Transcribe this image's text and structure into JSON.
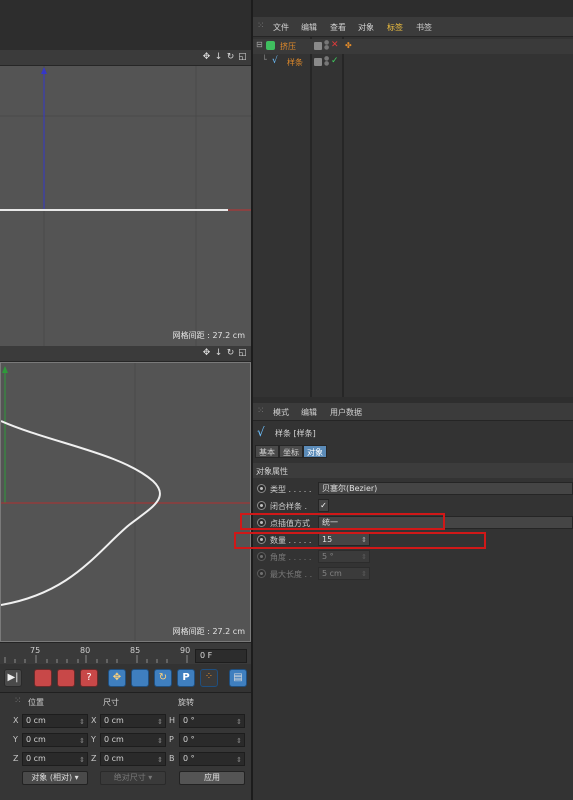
{
  "viewport_top": {
    "grid_spacing": "网格间距 : 27.2 cm"
  },
  "viewport_bottom": {
    "grid_spacing": "网格间距 : 27.2 cm"
  },
  "timeline": {
    "ticks": [
      "75",
      "80",
      "85",
      "90"
    ],
    "frame": "0 F"
  },
  "coord_manager": {
    "headers": {
      "position": "位置",
      "size": "尺寸",
      "rotation": "旋转"
    },
    "rows": [
      {
        "a": "X",
        "pos": "0 cm",
        "b": "X",
        "size": "0 cm",
        "c": "H",
        "rot": "0 °"
      },
      {
        "a": "Y",
        "pos": "0 cm",
        "b": "Y",
        "size": "0 cm",
        "c": "P",
        "rot": "0 °"
      },
      {
        "a": "Z",
        "pos": "0 cm",
        "b": "Z",
        "size": "0 cm",
        "c": "B",
        "rot": "0 °"
      }
    ],
    "mode_select": "对象 (相对)",
    "size_mode": "绝对尺寸",
    "apply": "应用"
  },
  "object_manager": {
    "menu": [
      "文件",
      "编辑",
      "查看",
      "对象",
      "标签",
      "书签"
    ],
    "objects": [
      {
        "name": "挤压"
      },
      {
        "name": "样条"
      }
    ]
  },
  "attribute_manager": {
    "menu": [
      "模式",
      "编辑",
      "用户数据"
    ],
    "title": "样条 [样条]",
    "tabs": [
      "基本",
      "坐标",
      "对象"
    ],
    "section": "对象属性",
    "props": [
      {
        "label": "类型 . . . . .",
        "value": "贝塞尔(Bezier)"
      },
      {
        "label": "闭合样条 .",
        "value": "✓"
      },
      {
        "label": "点插值方式",
        "value": "统一"
      },
      {
        "label": "数量 . . . . .",
        "value": "15"
      },
      {
        "label": "角度 . . . . .",
        "value": "5 °"
      },
      {
        "label": "最大长度 . .",
        "value": "5 cm"
      }
    ]
  },
  "colors": {
    "highlight": "#d01818",
    "accent_blue": "#3f7fbf",
    "spline_icon": "#6ec1ff",
    "tag_orange": "#e08a2a"
  }
}
